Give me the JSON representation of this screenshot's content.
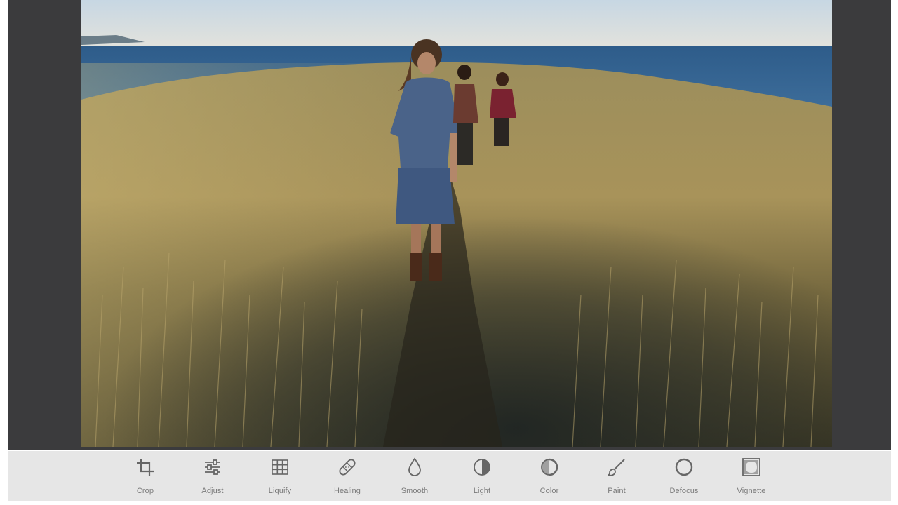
{
  "photo": {
    "scene": "hikers-on-grassy-hill-by-ocean"
  },
  "toolbar": {
    "icon_color": "#666666",
    "label_color": "#7a7a7a",
    "background": "#e6e6e6",
    "tools": [
      {
        "id": "crop",
        "label": "Crop",
        "icon": "crop-icon"
      },
      {
        "id": "adjust",
        "label": "Adjust",
        "icon": "sliders-icon"
      },
      {
        "id": "liquify",
        "label": "Liquify",
        "icon": "grid-icon"
      },
      {
        "id": "healing",
        "label": "Healing",
        "icon": "bandage-icon"
      },
      {
        "id": "smooth",
        "label": "Smooth",
        "icon": "droplet-icon"
      },
      {
        "id": "light",
        "label": "Light",
        "icon": "half-circle-icon"
      },
      {
        "id": "color",
        "label": "Color",
        "icon": "half-circle-stroke-icon"
      },
      {
        "id": "paint",
        "label": "Paint",
        "icon": "brush-icon"
      },
      {
        "id": "defocus",
        "label": "Defocus",
        "icon": "circle-icon"
      },
      {
        "id": "vignette",
        "label": "Vignette",
        "icon": "vignette-icon"
      }
    ]
  }
}
